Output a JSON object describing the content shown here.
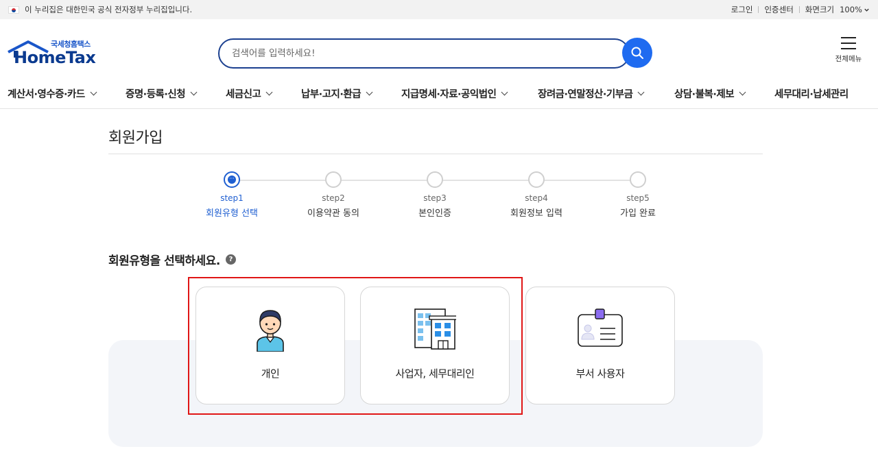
{
  "gov_banner": {
    "notice": "이 누리집은 대한민국 공식 전자정부 누리집입니다.",
    "login": "로그인",
    "cert_center": "인증센터",
    "zoom_label": "화면크기",
    "zoom_value": "100%"
  },
  "header": {
    "logo_sub": "국세청홈택스",
    "logo_main": "HomeTax",
    "search_placeholder": "검색어를 입력하세요!",
    "all_menu": "전체메뉴"
  },
  "gnb": {
    "items": [
      {
        "label": "계산서·영수증·카드"
      },
      {
        "label": "증명·등록·신청"
      },
      {
        "label": "세금신고"
      },
      {
        "label": "납부·고지·환급"
      },
      {
        "label": "지급명세·자료·공익법인"
      },
      {
        "label": "장려금·연말정산·기부금"
      },
      {
        "label": "상담·불복·제보"
      },
      {
        "label": "세무대리·납세관리"
      }
    ]
  },
  "page": {
    "title": "회원가입",
    "section_title": "회원유형을 선택하세요.",
    "help": "?"
  },
  "steps": [
    {
      "num": "step1",
      "label": "회원유형 선택",
      "active": true
    },
    {
      "num": "step2",
      "label": "이용약관 동의",
      "active": false
    },
    {
      "num": "step3",
      "label": "본인인증",
      "active": false
    },
    {
      "num": "step4",
      "label": "회원정보 입력",
      "active": false
    },
    {
      "num": "step5",
      "label": "가입 완료",
      "active": false
    }
  ],
  "member_types": [
    {
      "label": "개인",
      "icon": "person-icon"
    },
    {
      "label": "사업자, 세무대리인",
      "icon": "building-icon"
    },
    {
      "label": "부서 사용자",
      "icon": "id-card-icon"
    }
  ],
  "colors": {
    "brand_blue": "#1f6bf0",
    "step_active": "#1f5fd1",
    "highlight_red": "#e01515"
  }
}
